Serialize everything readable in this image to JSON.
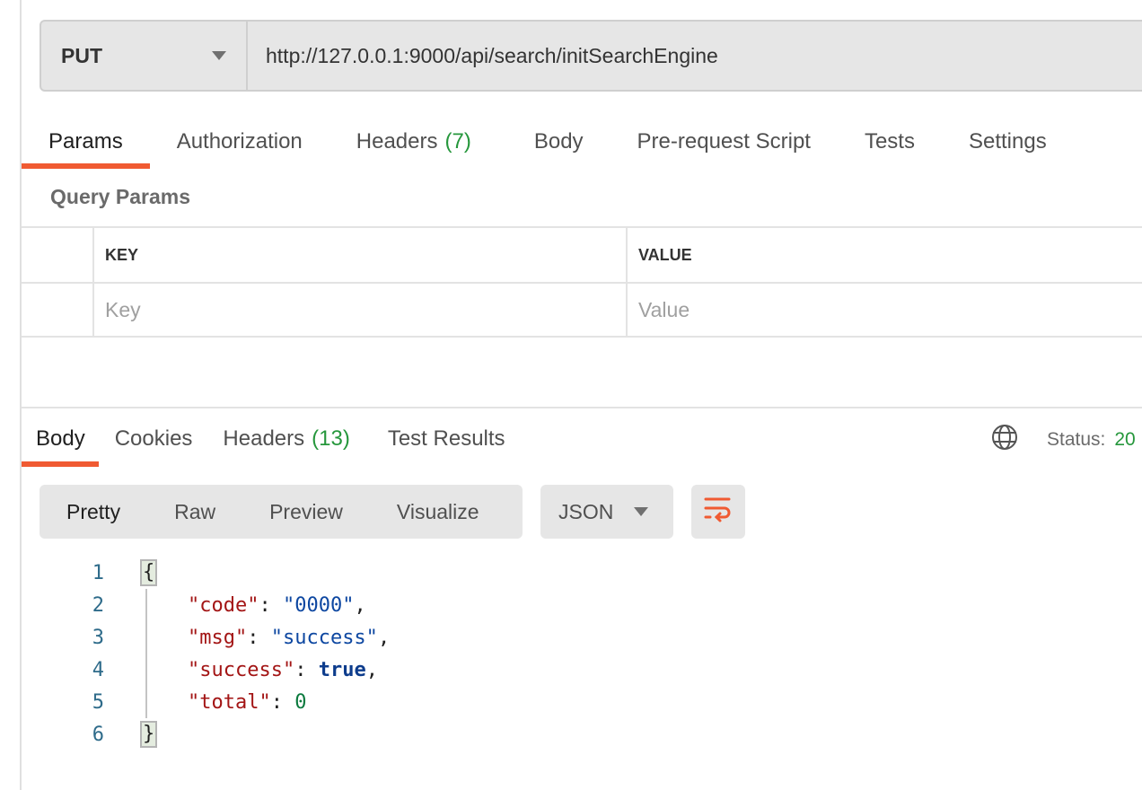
{
  "request": {
    "method": "PUT",
    "url": "http://127.0.0.1:9000/api/search/initSearchEngine"
  },
  "request_tabs": [
    {
      "label": "Params",
      "count": null,
      "active": true
    },
    {
      "label": "Authorization",
      "count": null
    },
    {
      "label": "Headers",
      "count": "(7)"
    },
    {
      "label": "Body",
      "count": null
    },
    {
      "label": "Pre-request Script",
      "count": null
    },
    {
      "label": "Tests",
      "count": null
    },
    {
      "label": "Settings",
      "count": null
    }
  ],
  "query_params": {
    "title": "Query Params",
    "columns": [
      "KEY",
      "VALUE"
    ],
    "placeholders": {
      "key": "Key",
      "value": "Value"
    }
  },
  "response_tabs": [
    {
      "label": "Body",
      "active": true
    },
    {
      "label": "Cookies"
    },
    {
      "label": "Headers",
      "count": "(13)"
    },
    {
      "label": "Test Results"
    }
  ],
  "status": {
    "icon": "globe-icon",
    "label": "Status:",
    "value": "20"
  },
  "view_modes": [
    "Pretty",
    "Raw",
    "Preview",
    "Visualize"
  ],
  "active_view_mode": "Pretty",
  "format": "JSON",
  "wrap_icon": "wrap-lines-icon",
  "response_body": {
    "line_numbers": [
      "1",
      "2",
      "3",
      "4",
      "5",
      "6"
    ],
    "open_brace": "{",
    "close_brace": "}",
    "fields": [
      {
        "key": "\"code\"",
        "value": "\"0000\"",
        "type": "string",
        "comma": ","
      },
      {
        "key": "\"msg\"",
        "value": "\"success\"",
        "type": "string",
        "comma": ","
      },
      {
        "key": "\"success\"",
        "value": "true",
        "type": "boolean",
        "comma": ","
      },
      {
        "key": "\"total\"",
        "value": "0",
        "type": "number",
        "comma": ""
      }
    ]
  },
  "colors": {
    "accent": "#f05a32",
    "count_green": "#26973c",
    "json_key": "#a31515",
    "json_string": "#0d47a1",
    "json_number": "#0b7a3e"
  }
}
